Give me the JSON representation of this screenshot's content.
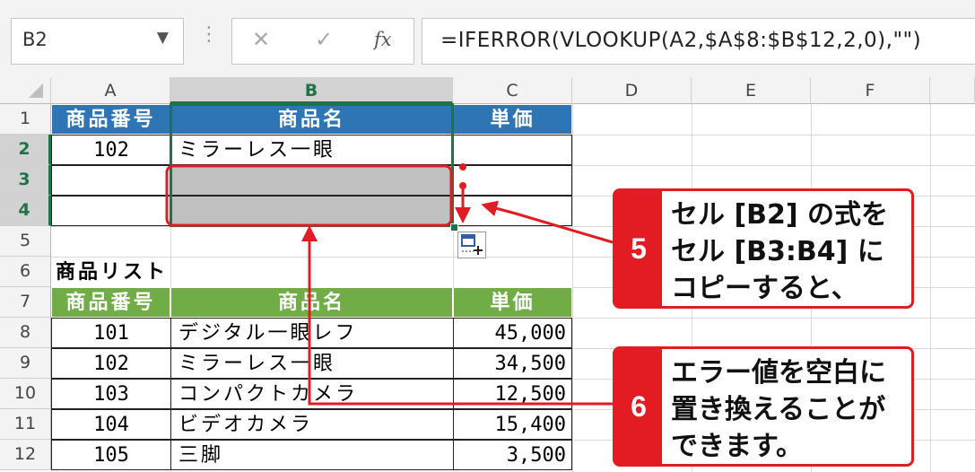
{
  "formula_bar": {
    "name_box": "B2",
    "name_box_dropdown": "▼",
    "separator": "⋮",
    "cancel": "✕",
    "enter": "✓",
    "fx": "fx",
    "formula": "=IFERROR(VLOOKUP(A2,$A$8:$B$12,2,0),\"\")"
  },
  "columns": [
    "A",
    "B",
    "C",
    "D",
    "E",
    "F"
  ],
  "rows": [
    "1",
    "2",
    "3",
    "4",
    "5",
    "6",
    "7",
    "8",
    "9",
    "10",
    "11",
    "12"
  ],
  "table1": {
    "headers": [
      "商品番号",
      "商品名",
      "単価"
    ],
    "row2": {
      "code": "102",
      "name": "ミラーレス一眼",
      "price": ""
    }
  },
  "list_title": "商品リスト",
  "table2": {
    "headers": [
      "商品番号",
      "商品名",
      "単価"
    ],
    "rows": [
      {
        "code": "101",
        "name": "デジタル一眼レフ",
        "price": "45,000"
      },
      {
        "code": "102",
        "name": "ミラーレス一眼",
        "price": "34,500"
      },
      {
        "code": "103",
        "name": "コンパクトカメラ",
        "price": "12,500"
      },
      {
        "code": "104",
        "name": "ビデオカメラ",
        "price": "15,400"
      },
      {
        "code": "105",
        "name": "三脚",
        "price": "3,500"
      }
    ]
  },
  "callouts": [
    {
      "number": "5",
      "lines": [
        "セル [B2] の式を",
        "セル [B3:B4] に",
        "コピーすると、"
      ]
    },
    {
      "number": "6",
      "lines": [
        "エラー値を空白に",
        "置き換えることが",
        "できます。"
      ]
    }
  ],
  "colors": {
    "accent": "#e31c23",
    "blue_header": "#2e75b6",
    "green_header": "#70ad47",
    "excel_green": "#217346"
  }
}
